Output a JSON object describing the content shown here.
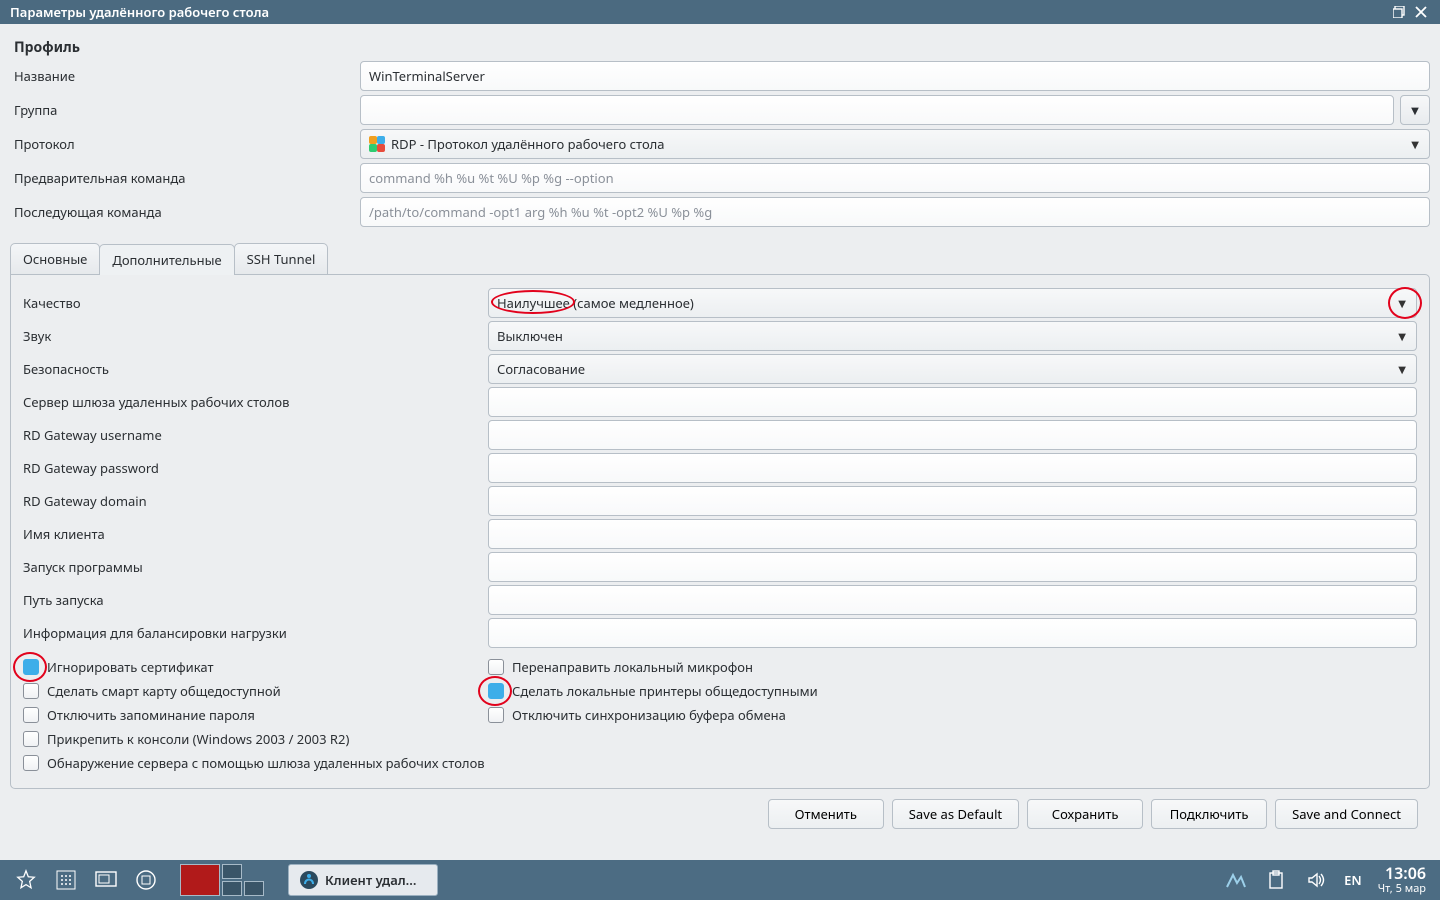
{
  "window": {
    "title": "Параметры удалённого рабочего стола"
  },
  "profile": {
    "heading": "Профиль",
    "name_label": "Название",
    "name_value": "WinTerminalServer",
    "group_label": "Группа",
    "group_value": "",
    "protocol_label": "Протокол",
    "protocol_value": "RDP - Протокол удалённого рабочего стола",
    "precmd_label": "Предварительная команда",
    "precmd_placeholder": "command %h %u %t %U %p %g --option",
    "postcmd_label": "Последующая команда",
    "postcmd_placeholder": "/path/to/command -opt1 arg %h %u %t -opt2 %U %p %g"
  },
  "tabs": {
    "basic": "Основные",
    "advanced": "Дополнительные",
    "ssh": "SSH Tunnel"
  },
  "adv": {
    "quality_label": "Качество",
    "quality_value": "Наилучшее (самое медленное)",
    "sound_label": "Звук",
    "sound_value": "Выключен",
    "security_label": "Безопасность",
    "security_value": "Согласование",
    "gateway_label": "Сервер шлюза удаленных рабочих столов",
    "gw_user_label": "RD Gateway username",
    "gw_pass_label": "RD Gateway password",
    "gw_domain_label": "RD Gateway domain",
    "client_name_label": "Имя клиента",
    "start_prog_label": "Запуск программы",
    "start_path_label": "Путь запуска",
    "loadbal_label": "Информация для балансировки нагрузки",
    "ignore_cert": "Игнорировать сертификат",
    "redirect_mic": "Перенаправить локальный микрофон",
    "share_smartcard": "Сделать смарт карту общедоступной",
    "share_printers": "Сделать локальные принтеры общедоступными",
    "disable_pass_store": "Отключить запоминание пароля",
    "disable_clip_sync": "Отключить синхронизацию буфера обмена",
    "attach_console": "Прикрепить к консоли (Windows 2003 / 2003 R2)",
    "detect_gateway": "Обнаружение сервера с помощью шлюза удаленных рабочих столов"
  },
  "buttons": {
    "cancel": "Отменить",
    "save_default": "Save as Default",
    "save": "Сохранить",
    "connect": "Подключить",
    "save_connect": "Save and Connect"
  },
  "taskbar": {
    "app": "Клиент удал...",
    "lang": "EN",
    "time": "13:06",
    "date": "Чт,  5 мар"
  }
}
